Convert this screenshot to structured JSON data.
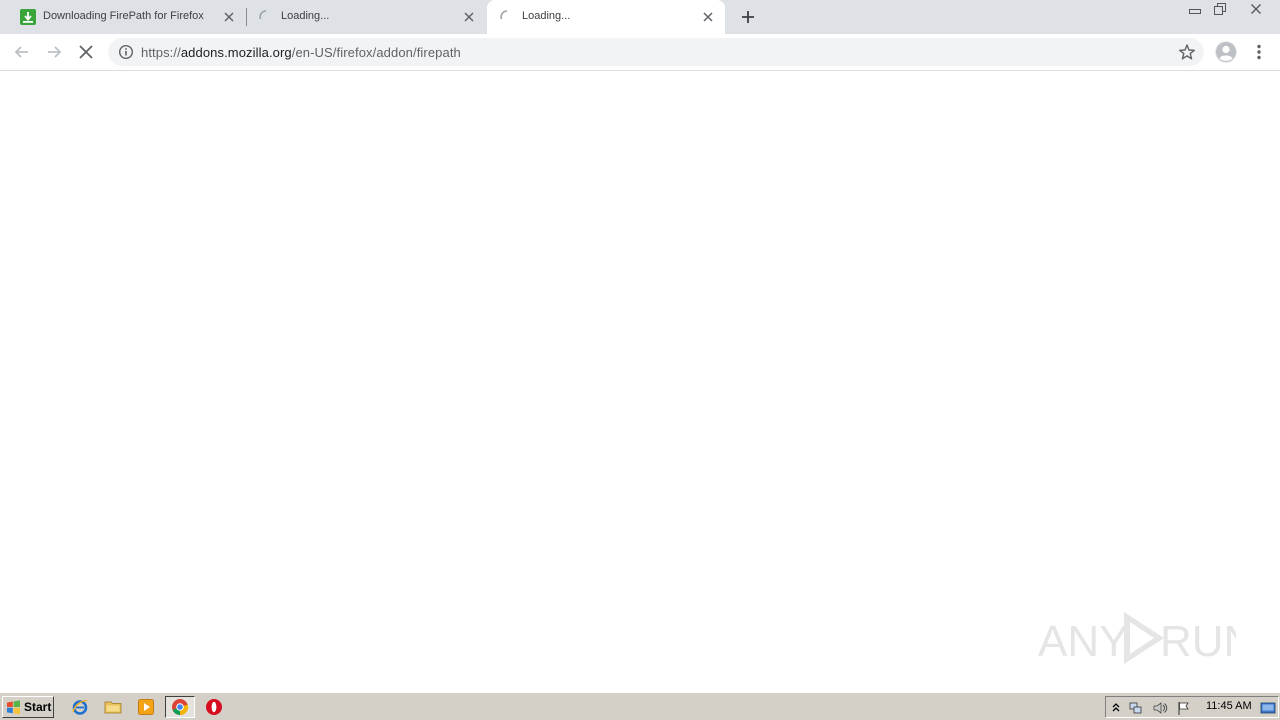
{
  "tabs": [
    {
      "title": "Downloading FirePath for Firefox",
      "icon": "download-favicon"
    },
    {
      "title": "Loading...",
      "icon": "loading-spinner-icon"
    },
    {
      "title": "Loading...",
      "icon": "loading-spinner-icon",
      "active": true
    }
  ],
  "omnibox": {
    "url_scheme": "https://",
    "url_host": "addons.mozilla.org",
    "url_path": "/en-US/firefox/addon/firepath"
  },
  "watermark": {
    "text_left": "ANY",
    "text_right": "RUN"
  },
  "taskbar": {
    "start_label": "Start",
    "apps": [
      "internet-explorer-icon",
      "folder-icon",
      "media-player-icon",
      "chrome-icon",
      "opera-icon"
    ],
    "clock": "11:45 AM"
  },
  "colors": {
    "tabstrip": "#dee1e6",
    "omnibox": "#f1f3f4",
    "taskbar": "#d4d0c8"
  }
}
